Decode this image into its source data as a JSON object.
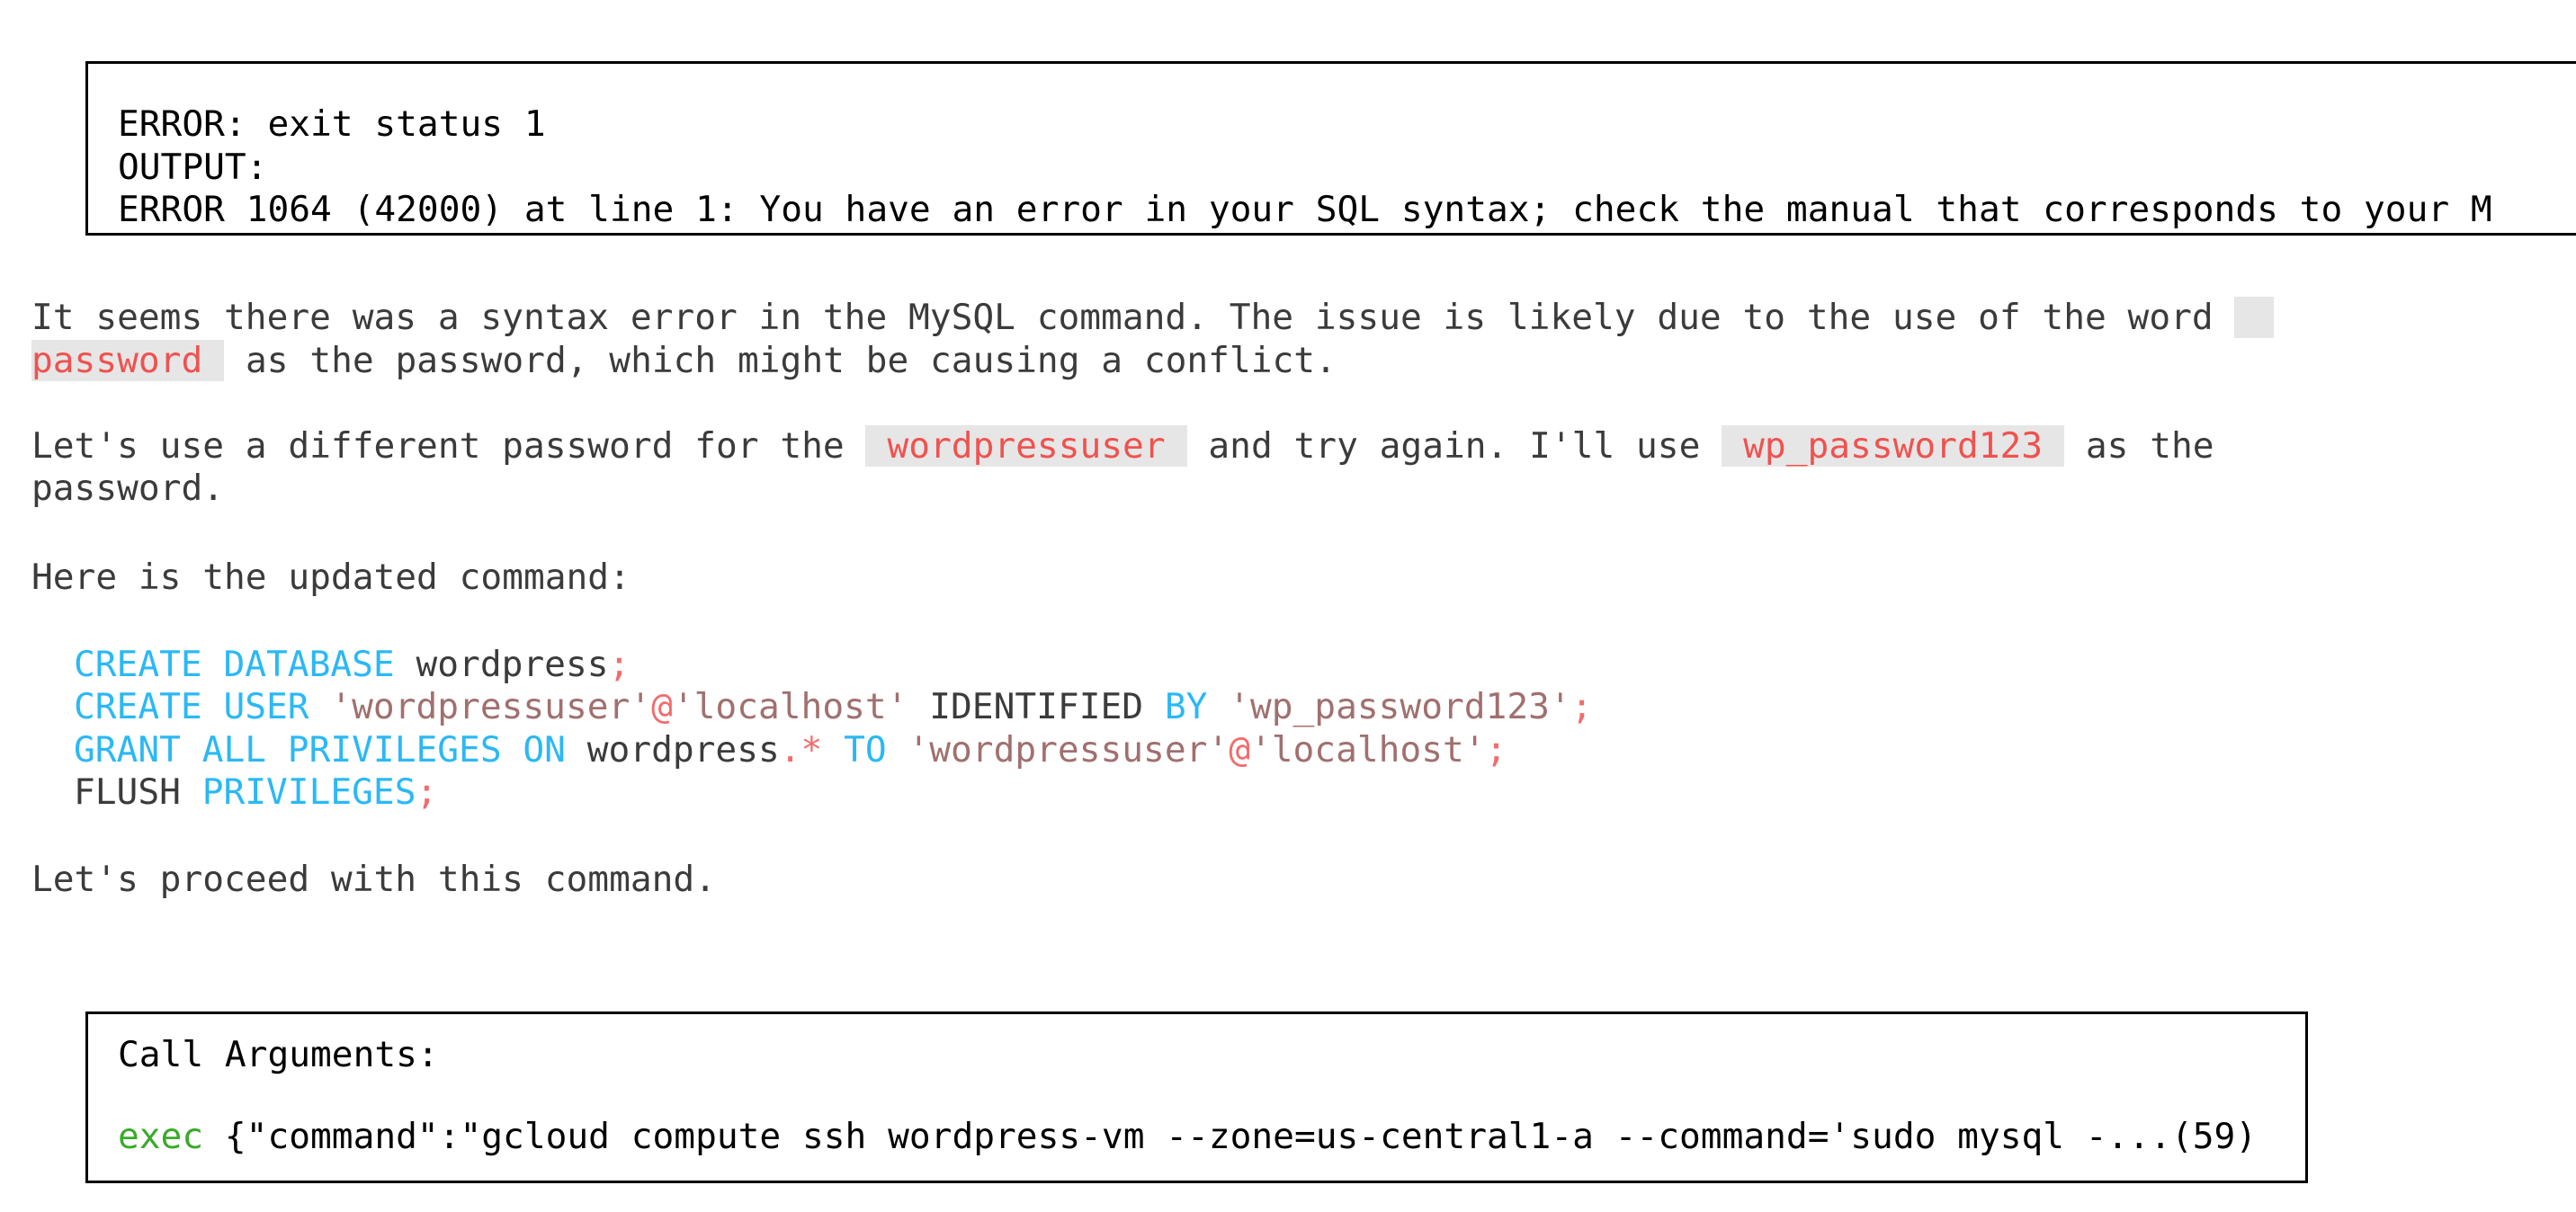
{
  "output_box": {
    "line1": "ERROR: exit status 1",
    "line2": "OUTPUT:",
    "line3": "ERROR 1064 (42000) at line 1: You have an error in your SQL syntax; check the manual that corresponds to your M"
  },
  "para1": {
    "text_a": "It seems there was a syntax error in the MySQL command. The issue is likely due to the use of the word",
    "code": "password",
    "text_b": " as the password, which might be causing a conflict."
  },
  "para2": {
    "text_a": "Let's use a different password for the ",
    "code1": "wordpressuser",
    "text_b": " and try again. I'll use ",
    "code2": "wp_password123",
    "text_c": " as the",
    "text_d": "password."
  },
  "para3": "Here is the updated command:",
  "code_block": {
    "l1": {
      "k1": "CREATE DATABASE",
      "t1": " wordpress",
      "p1": ";"
    },
    "l2": {
      "k1": "CREATE USER",
      "s1": " 'wordpressuser'",
      "p1": "@",
      "s2": "'localhost'",
      "t1": " IDENTIFIED ",
      "k2": "BY",
      "s3": " 'wp_password123'",
      "p2": ";"
    },
    "l3": {
      "k1": "GRANT ALL PRIVILEGES ON",
      "t1": " wordpress",
      "p1": ".*",
      "k2": " TO",
      "s1": " 'wordpressuser'",
      "p2": "@",
      "s2": "'localhost'",
      "p3": ";"
    },
    "l4": {
      "t1": "FLUSH ",
      "k1": "PRIVILEGES",
      "p1": ";"
    }
  },
  "para4": "Let's proceed with this command.",
  "call_box": {
    "title": "Call Arguments:",
    "func": "exec",
    "args": " {\"command\":\"gcloud compute ssh wordpress-vm --zone=us-central1-a --command='sudo mysql -...(59)"
  },
  "colors": {
    "keyword": "#2bb8f5",
    "string": "#a0706f",
    "punct": "#f36b6b",
    "inline_code": "#f0524f",
    "inline_code_bg": "#e6e6e6",
    "func": "#3aaa2a"
  }
}
